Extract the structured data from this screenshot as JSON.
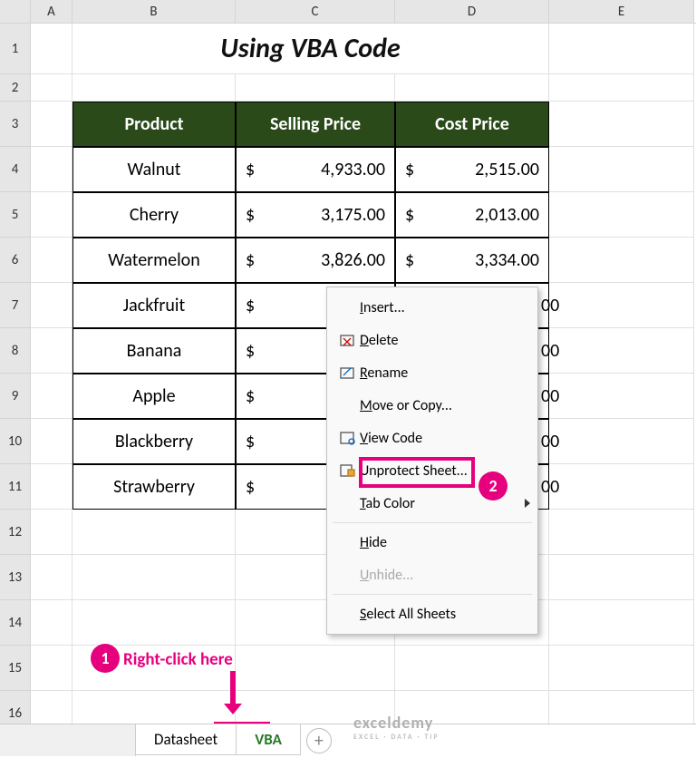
{
  "title": "Using VBA Code",
  "columns": [
    "A",
    "B",
    "C",
    "D",
    "E"
  ],
  "row_numbers": [
    "1",
    "2",
    "3",
    "4",
    "5",
    "6",
    "7",
    "8",
    "9",
    "10",
    "11",
    "12",
    "13",
    "14",
    "15",
    "16"
  ],
  "headers": {
    "product": "Product",
    "selling": "Selling Price",
    "cost": "Cost Price"
  },
  "currency": "$",
  "data": [
    {
      "product": "Walnut",
      "selling": "4,933.00",
      "cost": "2,515.00"
    },
    {
      "product": "Cherry",
      "selling": "3,175.00",
      "cost": "2,013.00"
    },
    {
      "product": "Watermelon",
      "selling": "3,826.00",
      "cost": "3,334.00"
    },
    {
      "product": "Jackfruit",
      "selling": "",
      "cost": ""
    },
    {
      "product": "Banana",
      "selling": "",
      "cost": ""
    },
    {
      "product": "Apple",
      "selling": "",
      "cost": ""
    },
    {
      "product": "Blackberry",
      "selling": "",
      "cost": ""
    },
    {
      "product": "Strawberry",
      "selling": "",
      "cost": ""
    }
  ],
  "partial_cost": [
    "00",
    "00",
    "00",
    "00",
    "00"
  ],
  "menu": {
    "insert": "Insert...",
    "delete": "Delete",
    "rename": "Rename",
    "move": "Move or Copy...",
    "viewcode": "View Code",
    "unprotect": "Unprotect Sheet...",
    "tabcolor": "Tab Color",
    "hide": "Hide",
    "unhide": "Unhide...",
    "selectall": "Select All Sheets"
  },
  "annotation": {
    "badge1": "1",
    "badge2": "2",
    "rc_text": "Right-click here"
  },
  "tabs": {
    "datasheet": "Datasheet",
    "vba": "VBA"
  },
  "watermark": {
    "main": "exceldemy",
    "sub": "EXCEL · DATA · TIP"
  }
}
